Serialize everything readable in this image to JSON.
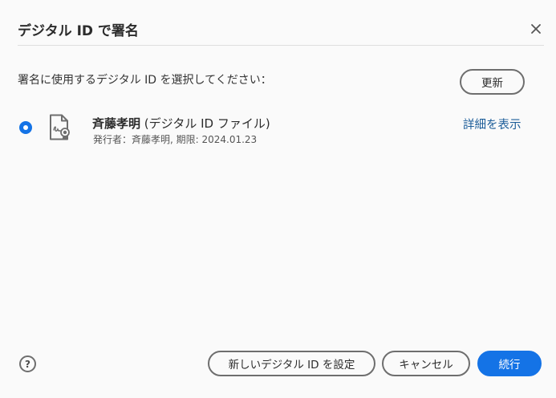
{
  "dialog": {
    "title": "デジタル ID で署名",
    "prompt": "署名に使用するデジタル ID を選択してください：",
    "refresh_label": "更新"
  },
  "ids": [
    {
      "name": "斉藤孝明",
      "type": "(デジタル ID ファイル)",
      "meta": "発行者：斉藤孝明, 期限: 2024.01.23",
      "details_label": "詳細を表示",
      "selected": true
    }
  ],
  "footer": {
    "help_symbol": "?",
    "new_id_label": "新しいデジタル ID を設定",
    "cancel_label": "キャンセル",
    "continue_label": "続行"
  },
  "colors": {
    "accent": "#1473e6",
    "link": "#1c5d99"
  },
  "icons": {
    "close": "close-icon",
    "certificate": "certificate-file-icon",
    "help": "help-icon"
  }
}
